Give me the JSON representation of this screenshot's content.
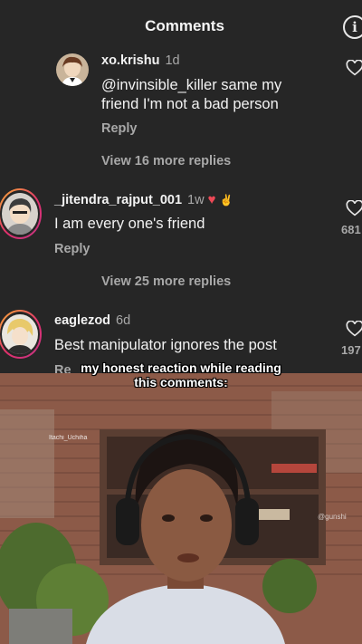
{
  "header": {
    "title": "Comments",
    "info_icon": "info-icon"
  },
  "comments": [
    {
      "username": "xo.krishu",
      "age": "1d",
      "text_lines": [
        "@invinsible_killer same my",
        "friend I'm not a bad person"
      ],
      "reply_label": "Reply",
      "more_replies": "View 16 more replies",
      "likes": ""
    },
    {
      "username": "_jitendra_rajput_001",
      "age": "1w",
      "text_lines": [
        "I am every one's friend"
      ],
      "reply_label": "Reply",
      "more_replies": "View 25 more replies",
      "likes": "681"
    },
    {
      "username": "eaglezod",
      "age": "6d",
      "text_lines": [
        "Best manipulator ignores the post"
      ],
      "reply_label": "Re",
      "likes": "197"
    }
  ],
  "video": {
    "caption_lines": [
      "my honest reaction while reading",
      "this comments:"
    ],
    "watermark_left": "Itachi_Uchiha",
    "watermark_right": "@gunshi"
  },
  "colors": {
    "panel_bg": "#262626",
    "muted_text": "#a8a8a8",
    "heart_red": "#ed4956"
  }
}
